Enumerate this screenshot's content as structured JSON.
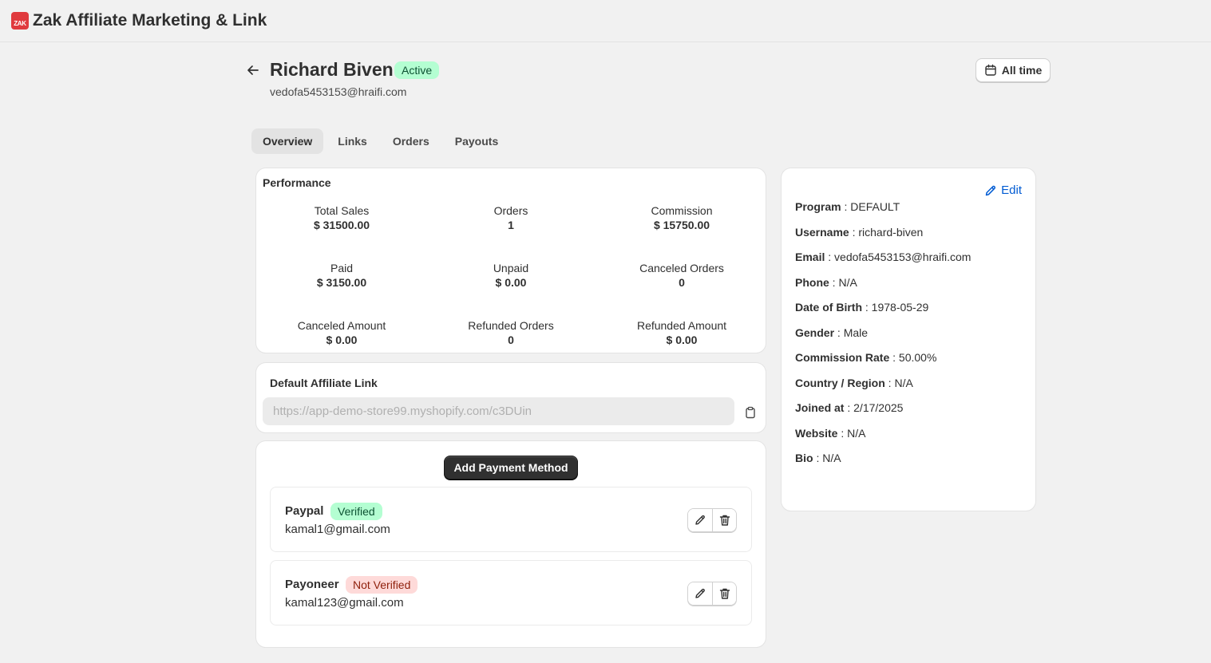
{
  "app": {
    "logo_text": "ZAK",
    "title": "Zak Affiliate Marketing & Link"
  },
  "header": {
    "name": "Richard Biven",
    "status": "Active",
    "email": "vedofa5453153@hraifi.com",
    "date_filter": "All time"
  },
  "tabs": [
    {
      "label": "Overview",
      "active": true
    },
    {
      "label": "Links"
    },
    {
      "label": "Orders"
    },
    {
      "label": "Payouts"
    }
  ],
  "performance": {
    "title": "Performance",
    "metrics": [
      {
        "label": "Total Sales",
        "value": "$ 31500.00"
      },
      {
        "label": "Orders",
        "value": "1"
      },
      {
        "label": "Commission",
        "value": "$ 15750.00"
      },
      {
        "label": "Paid",
        "value": "$ 3150.00"
      },
      {
        "label": "Unpaid",
        "value": "$ 0.00"
      },
      {
        "label": "Canceled Orders",
        "value": "0"
      },
      {
        "label": "Canceled Amount",
        "value": "$ 0.00"
      },
      {
        "label": "Refunded Orders",
        "value": "0"
      },
      {
        "label": "Refunded Amount",
        "value": "$ 0.00"
      }
    ]
  },
  "affiliate_link": {
    "title": "Default Affiliate Link",
    "value": "https://app-demo-store99.myshopify.com/c3DUin"
  },
  "payment": {
    "add_label": "Add Payment Method",
    "methods": [
      {
        "name": "Paypal",
        "status": "Verified",
        "email": "kamal1@gmail.com"
      },
      {
        "name": "Payoneer",
        "status": "Not Verified",
        "email": "kamal123@gmail.com"
      }
    ]
  },
  "profile": {
    "edit_label": "Edit",
    "fields": [
      {
        "label": "Program",
        "value": "DEFAULT"
      },
      {
        "label": "Username",
        "value": "richard-biven"
      },
      {
        "label": "Email",
        "value": "vedofa5453153@hraifi.com"
      },
      {
        "label": "Phone",
        "value": "N/A"
      },
      {
        "label": "Date of Birth",
        "value": "1978-05-29"
      },
      {
        "label": "Gender",
        "value": "Male"
      },
      {
        "label": "Commission Rate",
        "value": "50.00%"
      },
      {
        "label": "Country / Region",
        "value": "N/A"
      },
      {
        "label": "Joined at",
        "value": "2/17/2025"
      },
      {
        "label": "Website",
        "value": "N/A"
      },
      {
        "label": "Bio",
        "value": "N/A"
      }
    ]
  },
  "colors": {
    "brand": "#e03a3e",
    "link": "#005bd3",
    "success_bg": "#b4fed2",
    "critical_bg": "#fedad9",
    "primary_btn": "#303030"
  }
}
